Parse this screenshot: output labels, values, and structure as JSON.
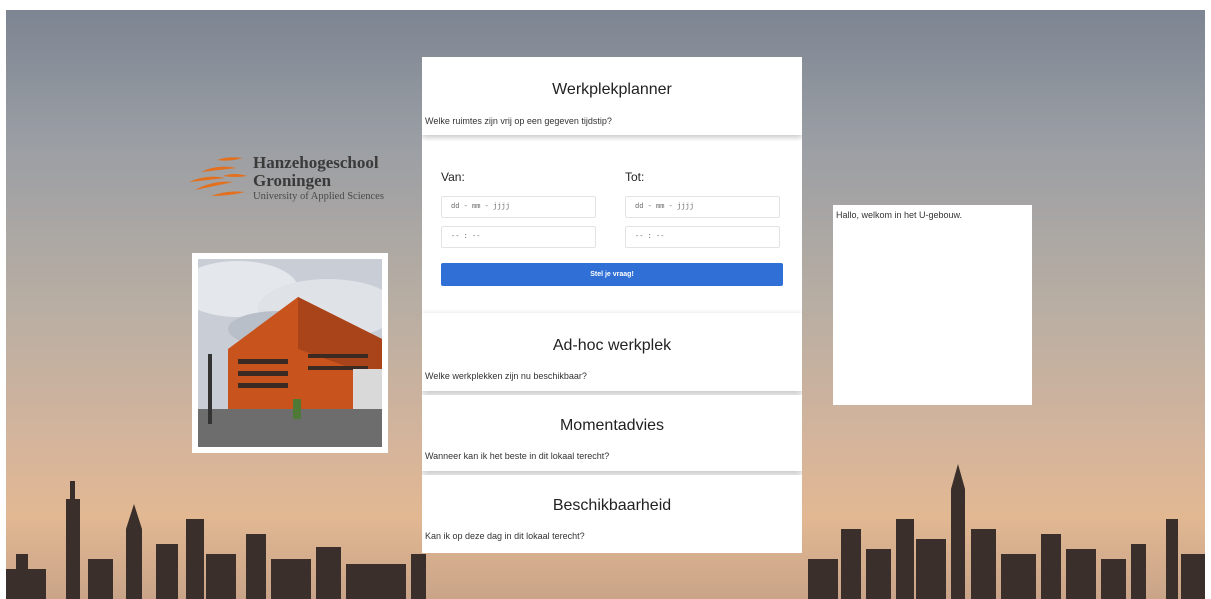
{
  "logo": {
    "line1": "Hanzehogeschool",
    "line2": "Groningen",
    "line3": "University of Applied Sciences",
    "accent": "#e2701f"
  },
  "planner": {
    "title": "Werkplekplanner",
    "subtitle": "Welke ruimtes zijn vrij op een gegeven tijdstip?",
    "from_label": "Van:",
    "to_label": "Tot:",
    "from_date_placeholder": "dd - mm - jjjj",
    "to_date_placeholder": "dd - mm - jjjj",
    "from_time_placeholder": "-- : --",
    "to_time_placeholder": "-- : --",
    "button_label": "Stel je vraag!",
    "button_color": "#2f6fd6"
  },
  "cards": [
    {
      "title": "Ad-hoc werkplek",
      "subtitle": "Welke werkplekken zijn nu beschikbaar?"
    },
    {
      "title": "Momentadvies",
      "subtitle": "Wanneer kan ik het beste in dit lokaal terecht?"
    },
    {
      "title": "Beschikbaarheid",
      "subtitle": "Kan ik op deze dag in dit lokaal terecht?"
    }
  ],
  "chat": {
    "message": "Hallo, welkom in het U-gebouw."
  }
}
